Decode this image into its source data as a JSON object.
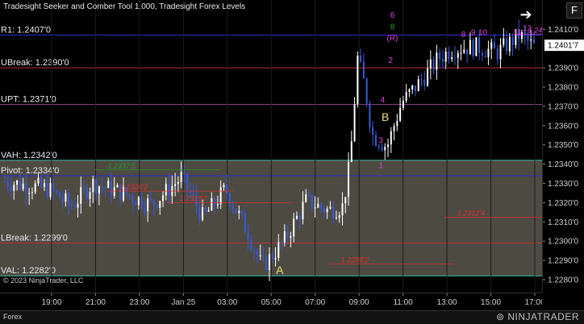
{
  "app": {
    "title": "Tradesight Seeker and Comber Tool 1.000, Tradesight Forex Levels",
    "copyright": "© 2023 NinjaTrader, LLC",
    "instrument_tab": "Forex",
    "brand": "NINJATRADER",
    "panel_button": "F",
    "nav_icon": "arrow-right-icon"
  },
  "chart_data": {
    "type": "candlestick",
    "x_ticks": [
      "19:00",
      "21:00",
      "23:00",
      "Jan 25",
      "03:00",
      "05:00",
      "07:00",
      "09:00",
      "11:00",
      "13:00",
      "15:00",
      "17:00"
    ],
    "y_ticks": [
      "1.2410'0",
      "1.2390'0",
      "1.2380'0",
      "1.2370'0",
      "1.2360'0",
      "1.2350'0",
      "1.2340'0",
      "1.2330'0",
      "1.2320'0",
      "1.2310'0",
      "1.2300'0",
      "1.2290'0",
      "1.2280'0"
    ],
    "ylim": [
      1.228,
      1.2416
    ],
    "last_price_label": "1.2401'7",
    "levels": [
      {
        "label": "R1: 1.2407'0",
        "value": 1.2407,
        "color": "#2b2bd0"
      },
      {
        "label": "UBreak: 1.2390'0",
        "value": 1.239,
        "color": "#c03030"
      },
      {
        "label": "UPT: 1.2371'0",
        "value": 1.2371,
        "color": "#8a3a8a"
      },
      {
        "label": "VAH: 1.2342'0",
        "value": 1.2342,
        "color": "#40c0b0"
      },
      {
        "label": "Pivot: 1.2334'0",
        "value": 1.2334,
        "color": "#2b2bd0"
      },
      {
        "label": "LBreak: 1.2299'0",
        "value": 1.2299,
        "color": "#c03030"
      },
      {
        "label": "VAL: 1.2282'0",
        "value": 1.2282,
        "color": "#40c0b0"
      }
    ],
    "value_area": [
      1.2282,
      1.2342
    ],
    "value_area_color": "#5a574e",
    "marker_labels": [
      {
        "text": "1.2326'2",
        "x": 11.9,
        "value": 1.2326,
        "color": "#e03030"
      },
      {
        "text": "1.2319'7",
        "x": 18.6,
        "value": 1.232,
        "color": "#e03030"
      },
      {
        "text": "1.2337'5",
        "x": 10.5,
        "value": 1.2337,
        "color": "#2a9a2a"
      },
      {
        "text": "1.2288'2",
        "x": 36.8,
        "value": 1.22882,
        "color": "#e03030"
      },
      {
        "text": "1.2312'4",
        "x": 49.9,
        "value": 1.23124,
        "color": "#e03030"
      },
      {
        "text": "1.2407'5",
        "x": 57.9,
        "value": 1.24075,
        "color": "#e040e0"
      }
    ],
    "letters": [
      {
        "text": "A",
        "x": 30.8,
        "value": 1.22855,
        "color": "#e8e070"
      },
      {
        "text": "B",
        "x": 42.7,
        "value": 1.2365,
        "color": "#e8e070"
      }
    ],
    "seq_counts": [
      {
        "text": "6",
        "x": 43.5,
        "value": 1.2416,
        "color": "#e040e0"
      },
      {
        "text": "8",
        "x": 43.5,
        "value": 1.241,
        "color": "#2a9a2a"
      },
      {
        "text": "(R)",
        "x": 43.5,
        "value": 1.2404,
        "color": "#e040e0"
      },
      {
        "text": "8",
        "x": 51.5,
        "value": 1.2406,
        "color": "#e040e0"
      },
      {
        "text": "9",
        "x": 52.6,
        "value": 1.2407,
        "color": "#e040e0"
      },
      {
        "text": "10",
        "x": 53.7,
        "value": 1.2407,
        "color": "#e040e0"
      },
      {
        "text": "11",
        "x": 57.6,
        "value": 1.2407,
        "color": "#e040e0"
      },
      {
        "text": "12",
        "x": 58.7,
        "value": 1.2409,
        "color": "#e040e0"
      },
      {
        "text": "2",
        "x": 43.3,
        "value": 1.23925,
        "color": "#e040e0"
      },
      {
        "text": "3",
        "x": 42.2,
        "value": 1.2351,
        "color": "#e040e0"
      },
      {
        "text": "1",
        "x": 42.2,
        "value": 1.2338,
        "color": "#e040e0"
      },
      {
        "text": "4",
        "x": 42.4,
        "value": 1.2372,
        "color": "#e040e0"
      }
    ]
  }
}
